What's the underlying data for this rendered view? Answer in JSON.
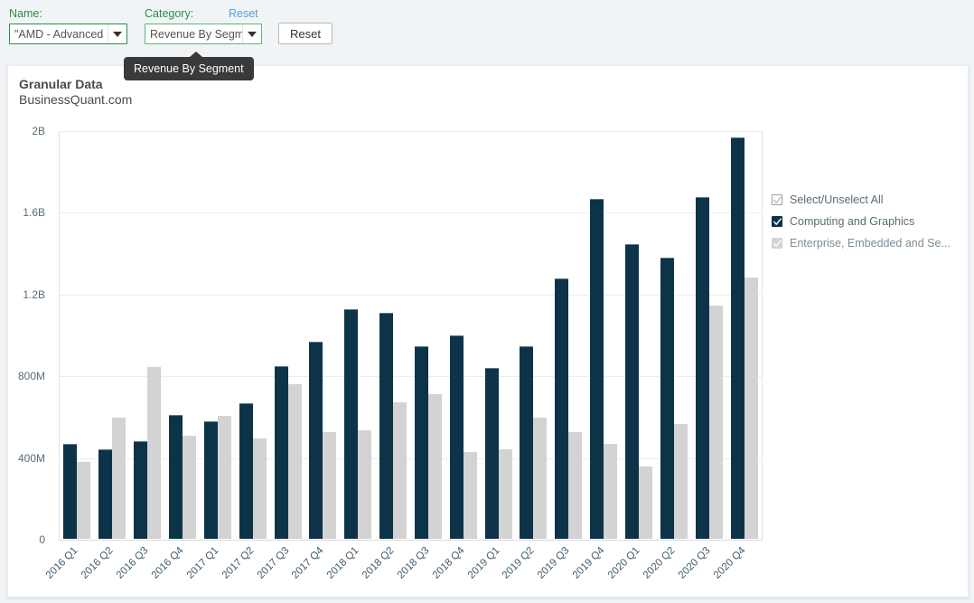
{
  "controls": {
    "name_label": "Name:",
    "name_value": "\"AMD - Advanced",
    "category_label": "Category:",
    "category_value": "Revenue By Segm",
    "category_reset_link": "Reset",
    "reset_button": "Reset",
    "dropdown_caret_icon": "chevron-down-icon"
  },
  "tooltip": {
    "text": "Revenue By Segment"
  },
  "panel": {
    "title_line1": "Granular Data",
    "title_line2": "BusinessQuant.com"
  },
  "legend": {
    "items": [
      {
        "label": "Select/Unselect All",
        "state": "all",
        "color": "#ffffff",
        "check_color": "#b8c0c5"
      },
      {
        "label": "Computing and Graphics",
        "state": "checked",
        "color": "#0d3349",
        "check_color": "#ffffff"
      },
      {
        "label": "Enterprise, Embedded and Se...",
        "state": "checked",
        "color": "#d3d3d3",
        "check_color": "#ffffff"
      }
    ]
  },
  "chart_data": {
    "type": "bar",
    "title": "Granular Data",
    "subtitle": "BusinessQuant.com",
    "xlabel": "",
    "ylabel": "",
    "ylim": [
      0,
      2000000000
    ],
    "grid": true,
    "legend_position": "right",
    "yticks": [
      0,
      400000000,
      800000000,
      1200000000,
      1600000000,
      2000000000
    ],
    "ytick_labels": [
      "0",
      "400M",
      "800M",
      "1.2B",
      "1.6B",
      "2B"
    ],
    "categories": [
      "2016 Q1",
      "2016 Q2",
      "2016 Q3",
      "2016 Q4",
      "2017 Q1",
      "2017 Q2",
      "2017 Q3",
      "2017 Q4",
      "2018 Q1",
      "2018 Q2",
      "2018 Q3",
      "2018 Q4",
      "2019 Q1",
      "2019 Q2",
      "2019 Q3",
      "2019 Q4",
      "2020 Q1",
      "2020 Q2",
      "2020 Q3",
      "2020 Q4"
    ],
    "series": [
      {
        "name": "Computing and Graphics",
        "color": "#0d3349",
        "values": [
          460000000,
          435000000,
          472000000,
          600000000,
          570000000,
          660000000,
          840000000,
          960000000,
          1120000000,
          1100000000,
          940000000,
          990000000,
          830000000,
          940000000,
          1270000000,
          1660000000,
          1440000000,
          1370000000,
          1670000000,
          1960000000
        ]
      },
      {
        "name": "Enterprise, Embedded and Semi-Custom",
        "color": "#d3d3d3",
        "values": [
          378000000,
          595000000,
          840000000,
          505000000,
          600000000,
          490000000,
          755000000,
          520000000,
          530000000,
          670000000,
          710000000,
          425000000,
          440000000,
          595000000,
          520000000,
          465000000,
          355000000,
          560000000,
          1140000000,
          1280000000
        ]
      }
    ]
  }
}
